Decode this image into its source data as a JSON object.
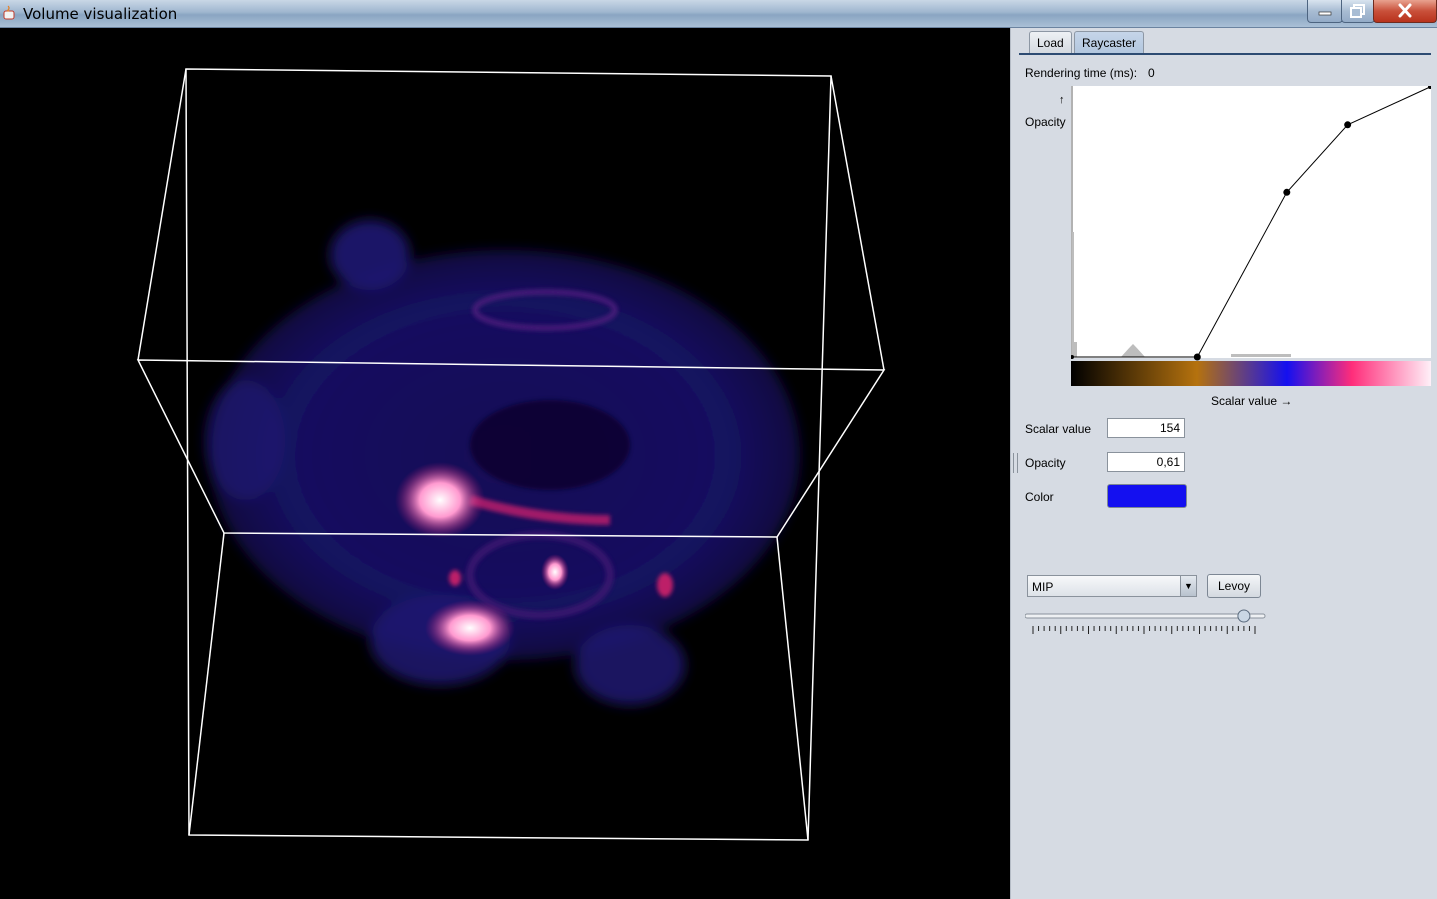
{
  "window": {
    "title": "Volume visualization",
    "controls": [
      "minimize-icon",
      "maximize-icon",
      "close-icon"
    ]
  },
  "tabs": [
    {
      "label": "Load",
      "selected": false
    },
    {
      "label": "Raycaster",
      "selected": true
    }
  ],
  "panel": {
    "rendering_time_label": "Rendering time (ms):",
    "rendering_time_value": "0",
    "opacity_axis_arrow": "↑",
    "opacity_axis_label": "Opacity",
    "scalar_axis_label": "Scalar value →",
    "scalar_value_label": "Scalar value",
    "scalar_value": "154",
    "opacity_label": "Opacity",
    "opacity_value": "0,61",
    "color_label": "Color",
    "color_value": "#1410f0",
    "mode_select_value": "MIP",
    "levoy_button_label": "Levoy",
    "slider_fraction": 0.95
  },
  "chart_data": {
    "type": "line",
    "title": "",
    "xlabel": "Scalar value →",
    "ylabel": "Opacity",
    "xlim": [
      0,
      1
    ],
    "ylim": [
      0,
      1
    ],
    "control_points": [
      {
        "x": 0.0,
        "y": 0.0
      },
      {
        "x": 0.35,
        "y": 0.0
      },
      {
        "x": 0.6,
        "y": 0.61
      },
      {
        "x": 0.77,
        "y": 0.86
      },
      {
        "x": 1.0,
        "y": 1.0
      }
    ],
    "colormap_stops": [
      {
        "pos": 0.0,
        "color": "#000000"
      },
      {
        "pos": 0.35,
        "color": "#b5720e"
      },
      {
        "pos": 0.6,
        "color": "#1410f0"
      },
      {
        "pos": 0.78,
        "color": "#ff2d7a"
      },
      {
        "pos": 1.0,
        "color": "#fff0f8"
      }
    ]
  }
}
